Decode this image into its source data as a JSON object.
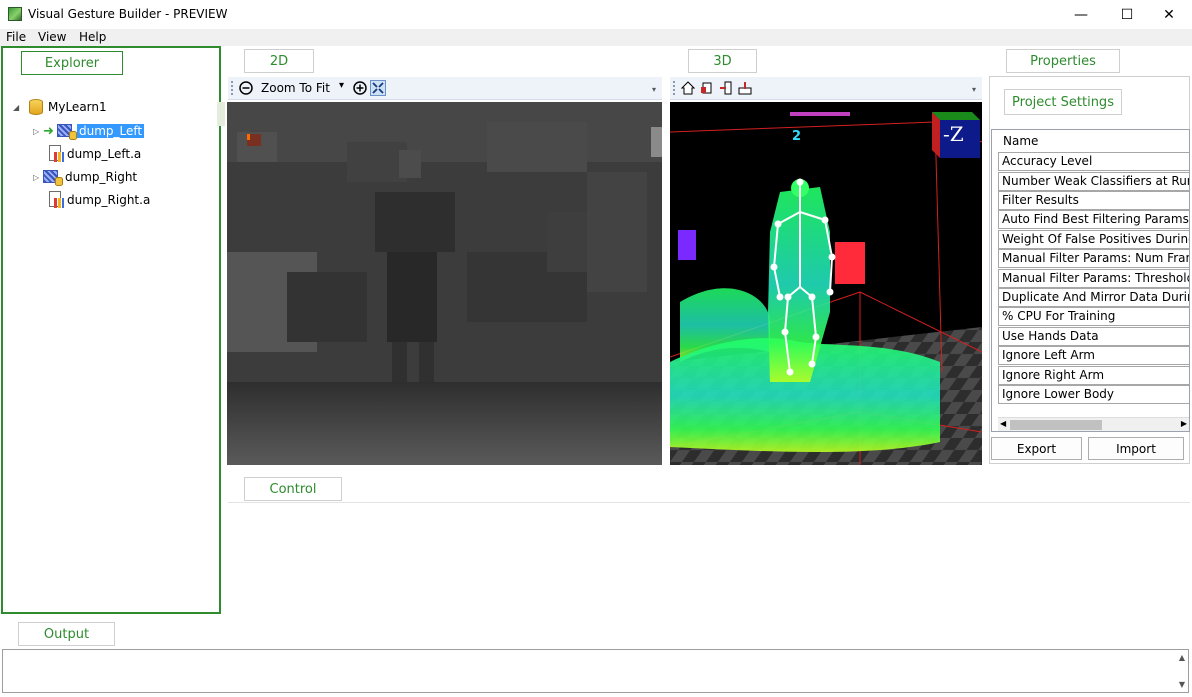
{
  "window": {
    "title": "Visual Gesture Builder - PREVIEW",
    "minimize": "—",
    "maximize": "☐",
    "close": "✕"
  },
  "menu": [
    {
      "label": "File"
    },
    {
      "label": "View"
    },
    {
      "label": "Help"
    }
  ],
  "explorer": {
    "tab_label": "Explorer",
    "root": "MyLearn1",
    "items": [
      {
        "label": "dump_Left",
        "selected": true
      },
      {
        "label": "dump_Left.a"
      },
      {
        "label": "dump_Right"
      },
      {
        "label": "dump_Right.a"
      }
    ]
  },
  "view2d": {
    "tab_label": "2D",
    "zoom_label": "Zoom To Fit",
    "dropdown_arrow": "▾"
  },
  "view3d": {
    "tab_label": "3D",
    "body_index": "2",
    "axis_cube_label": "-Z"
  },
  "properties": {
    "tab_label": "Properties",
    "project_settings": "Project Settings",
    "header": "Name",
    "rows": [
      "Accuracy Level",
      "Number Weak Classifiers at Runtime",
      "Filter Results",
      "Auto Find Best Filtering Params",
      "Weight Of False Positives During Auto Find",
      "Manual Filter Params: Num Frames",
      "Manual Filter Params: Threshold",
      "Duplicate And Mirror Data During Training",
      "% CPU For Training",
      "Use Hands Data",
      "Ignore Left Arm",
      "Ignore Right Arm",
      "Ignore Lower Body"
    ],
    "export_label": "Export",
    "import_label": "Import"
  },
  "control": {
    "tab_label": "Control"
  },
  "output": {
    "tab_label": "Output"
  },
  "colors": {
    "accent_green": "#2e8b2e",
    "selection_blue": "#3399ff",
    "skeleton_green": "#22ff44"
  }
}
